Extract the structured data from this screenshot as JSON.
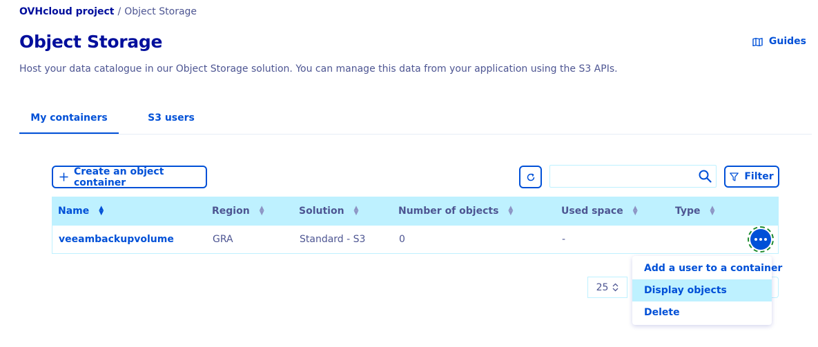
{
  "breadcrumb": {
    "project": "OVHcloud project",
    "separator": "/",
    "current": "Object Storage"
  },
  "page": {
    "title": "Object Storage",
    "description": "Host your data catalogue in our Object Storage solution. You can manage this data from your application using the S3 APIs.",
    "guides_label": "Guides"
  },
  "tabs": [
    {
      "label": "My containers",
      "active": true
    },
    {
      "label": "S3 users",
      "active": false
    }
  ],
  "toolbar": {
    "create_label": "Create an object container",
    "search_value": "",
    "filter_label": "Filter"
  },
  "table": {
    "columns": [
      "Name",
      "Region",
      "Solution",
      "Number of objects",
      "Used space",
      "Type"
    ],
    "rows": [
      {
        "name": "veeambackupvolume",
        "region": "GRA",
        "solution": "Standard - S3",
        "objects": "0",
        "used_space": "-",
        "type": ""
      }
    ]
  },
  "pagination": {
    "page_size": "25"
  },
  "action_menu": {
    "items": [
      "Add a user to a container",
      "Display objects",
      "Delete"
    ],
    "highlighted": "Display objects"
  },
  "colors": {
    "primary": "#0050d7",
    "dark": "#000e9c",
    "muted": "#4d5592",
    "highlight": "#bef1ff"
  }
}
